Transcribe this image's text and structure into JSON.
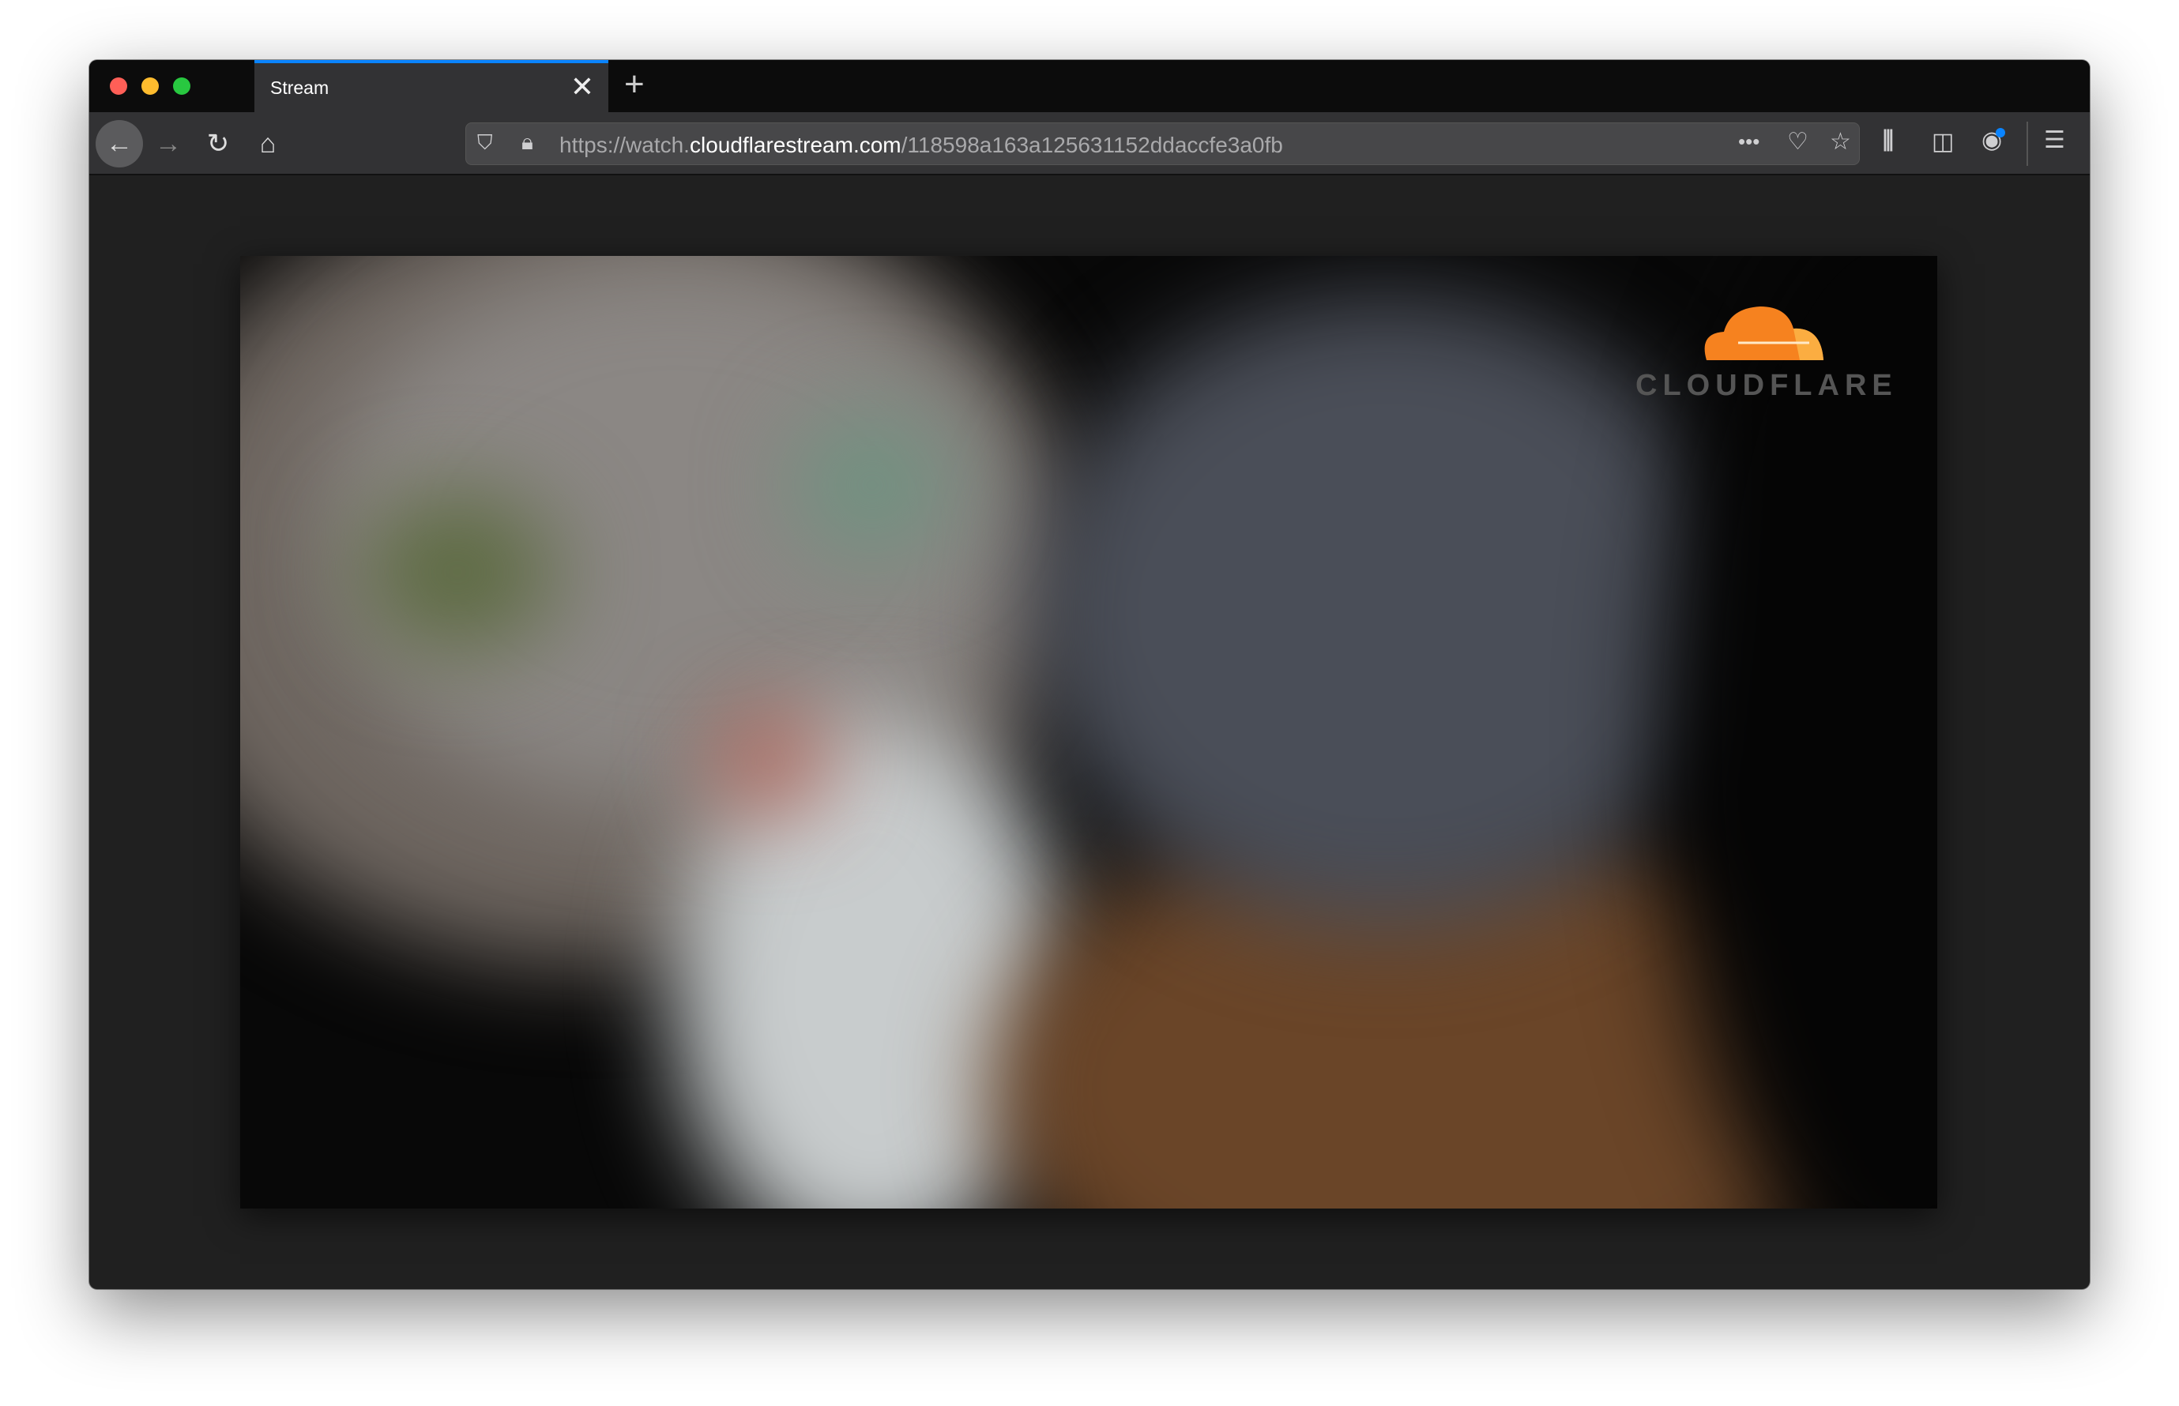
{
  "tab": {
    "title": "Stream",
    "close": "✕",
    "new_tab": "+"
  },
  "toolbar": {
    "back": "←",
    "forward": "→",
    "reload": "↻",
    "home": "⌂",
    "more": "•••",
    "hamburger": "☰"
  },
  "url": {
    "scheme_sub": "https://watch.",
    "domain": "cloudflarestream.com",
    "path": "/118598a163a125631152ddaccfe3a0fb"
  },
  "video": {
    "logo_text": "CLOUDFLARE",
    "logo_color": "#f6821f"
  },
  "colors": {
    "accent": "#0a84ff",
    "close": "#ff5f57",
    "minimize": "#febc2e",
    "maximize": "#28c840"
  }
}
